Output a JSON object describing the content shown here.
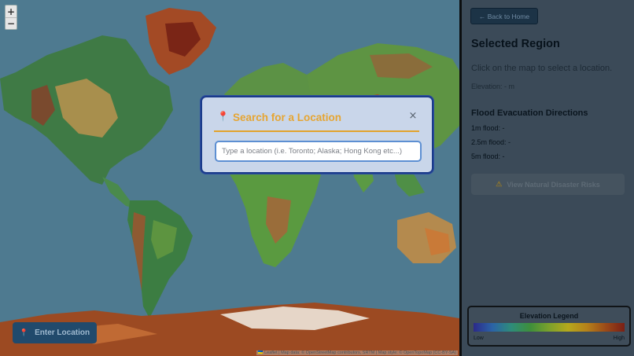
{
  "map": {
    "zoom_in": "+",
    "zoom_out": "−",
    "attribution": "🇺🇦 Leaflet | Map data: © OpenStreetMap contributors, SRTM | Map style: © OpenTopoMap (CC-BY-SA)",
    "enter_location_label": "Enter Location",
    "enter_location_icon": "map-pin-icon"
  },
  "panel": {
    "back_label": "← Back to Home",
    "title": "Selected Region",
    "hint": "Click on the map to select a location.",
    "elevation": "Elevation: - m",
    "flood_heading": "Flood Evacuation Directions",
    "flood": [
      {
        "label": "1m flood: -"
      },
      {
        "label": "2.5m flood: -"
      },
      {
        "label": "5m flood: -"
      }
    ],
    "risks_label": "View Natural Disaster Risks",
    "risks_icon": "warning-icon"
  },
  "legend": {
    "title": "Elevation Legend",
    "low": "Low",
    "high": "High"
  },
  "modal": {
    "title": "Search for a Location",
    "icon": "map-pin-icon",
    "close": "×",
    "placeholder": "Type a location (i.e. Toronto; Alaska; Hong Kong etc...)",
    "value": ""
  },
  "colors": {
    "accent_orange": "#e6a532",
    "modal_border": "#1a3b8a",
    "input_border": "#5d8fd2"
  }
}
